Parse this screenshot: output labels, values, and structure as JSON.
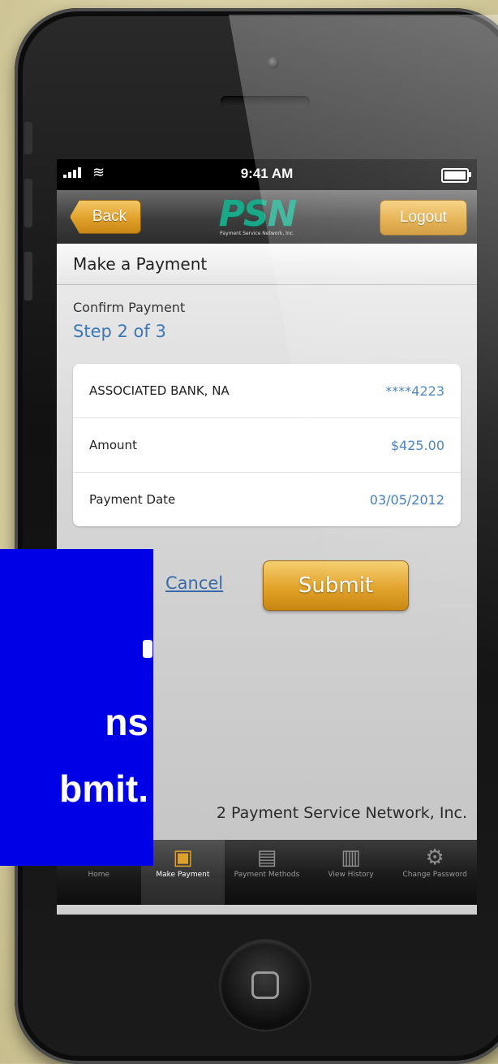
{
  "status_bar": {
    "time": "9:41 AM"
  },
  "nav": {
    "back_label": "Back",
    "logout_label": "Logout",
    "logo_mark": "PSN",
    "logo_sub": "Payment Service Network, Inc."
  },
  "page": {
    "title": "Make a Payment",
    "section": "Confirm Payment",
    "step": "Step 2 of 3"
  },
  "summary": [
    {
      "label": "ASSOCIATED BANK, NA",
      "value": "****4223"
    },
    {
      "label": "Amount",
      "value": "$425.00"
    },
    {
      "label": "Payment Date",
      "value": "03/05/2012"
    }
  ],
  "actions": {
    "cancel_label": "Cancel",
    "submit_label": "Submit"
  },
  "footer": {
    "text": "2 Payment Service Network, Inc."
  },
  "tabs": [
    {
      "label": "Home",
      "icon": "home-icon",
      "active": false
    },
    {
      "label": "Make Payment",
      "icon": "make-payment-icon",
      "active": true
    },
    {
      "label": "Payment Methods",
      "icon": "payment-methods-icon",
      "active": false
    },
    {
      "label": "View History",
      "icon": "history-icon",
      "active": false
    },
    {
      "label": "Change Password",
      "icon": "gear-icon",
      "active": false
    }
  ],
  "overlay": {
    "line1": "ns",
    "line2": "bmit."
  },
  "colors": {
    "accent": "#e0a12b",
    "link": "#3a78b8",
    "overlay_blue": "#0000e6"
  }
}
